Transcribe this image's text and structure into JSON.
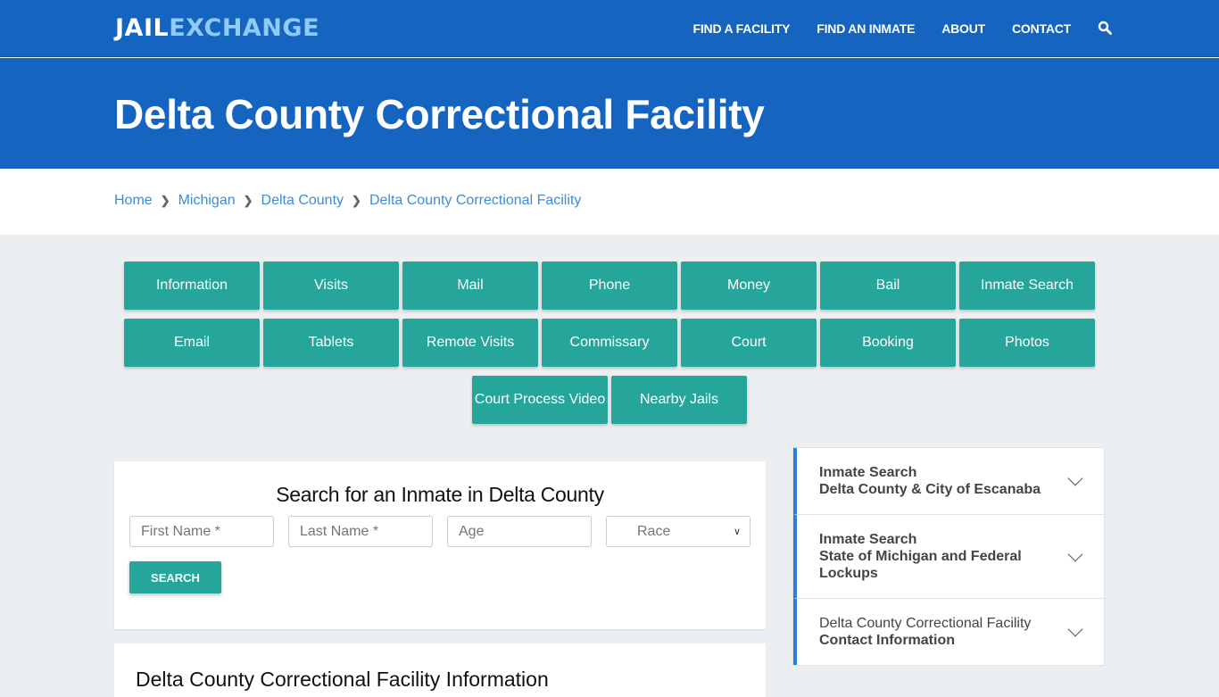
{
  "header": {
    "logo": {
      "part1": "JAIL",
      "part2": "EXCHANGE"
    },
    "nav": [
      {
        "label": "FIND A FACILITY"
      },
      {
        "label": "FIND AN INMATE"
      },
      {
        "label": "ABOUT"
      },
      {
        "label": "CONTACT"
      }
    ],
    "search_icon": "search-icon"
  },
  "page_title": "Delta County Correctional Facility",
  "breadcrumb": [
    {
      "label": "Home"
    },
    {
      "label": "Michigan"
    },
    {
      "label": "Delta County"
    },
    {
      "label": "Delta County Correctional Facility"
    }
  ],
  "tiles": {
    "row1": [
      "Information",
      "Visits",
      "Mail",
      "Phone",
      "Money",
      "Bail",
      "Inmate Search"
    ],
    "row2": [
      "Email",
      "Tablets",
      "Remote Visits",
      "Commissary",
      "Court",
      "Booking",
      "Photos"
    ],
    "row3": [
      "Court Process Video",
      "Nearby Jails"
    ]
  },
  "search": {
    "title": "Search for an Inmate in Delta County",
    "first_name_placeholder": "First Name *",
    "last_name_placeholder": "Last Name *",
    "age_placeholder": "Age",
    "race_selected": "Race",
    "button": "SEARCH"
  },
  "info": {
    "title": "Delta County Correctional Facility Information"
  },
  "sidebar": [
    {
      "line1": "Inmate Search",
      "line2": "Delta County & City of Escanaba"
    },
    {
      "line1": "Inmate Search",
      "line2": "State of Michigan and Federal Lockups"
    },
    {
      "line1": "Delta County Correctional Facility",
      "line2": "Contact Information"
    }
  ],
  "colors": {
    "brand_blue": "#1565c0",
    "teal": "#26a69a",
    "link_blue": "#3d8bd9",
    "logo_accent": "#90caf9"
  }
}
